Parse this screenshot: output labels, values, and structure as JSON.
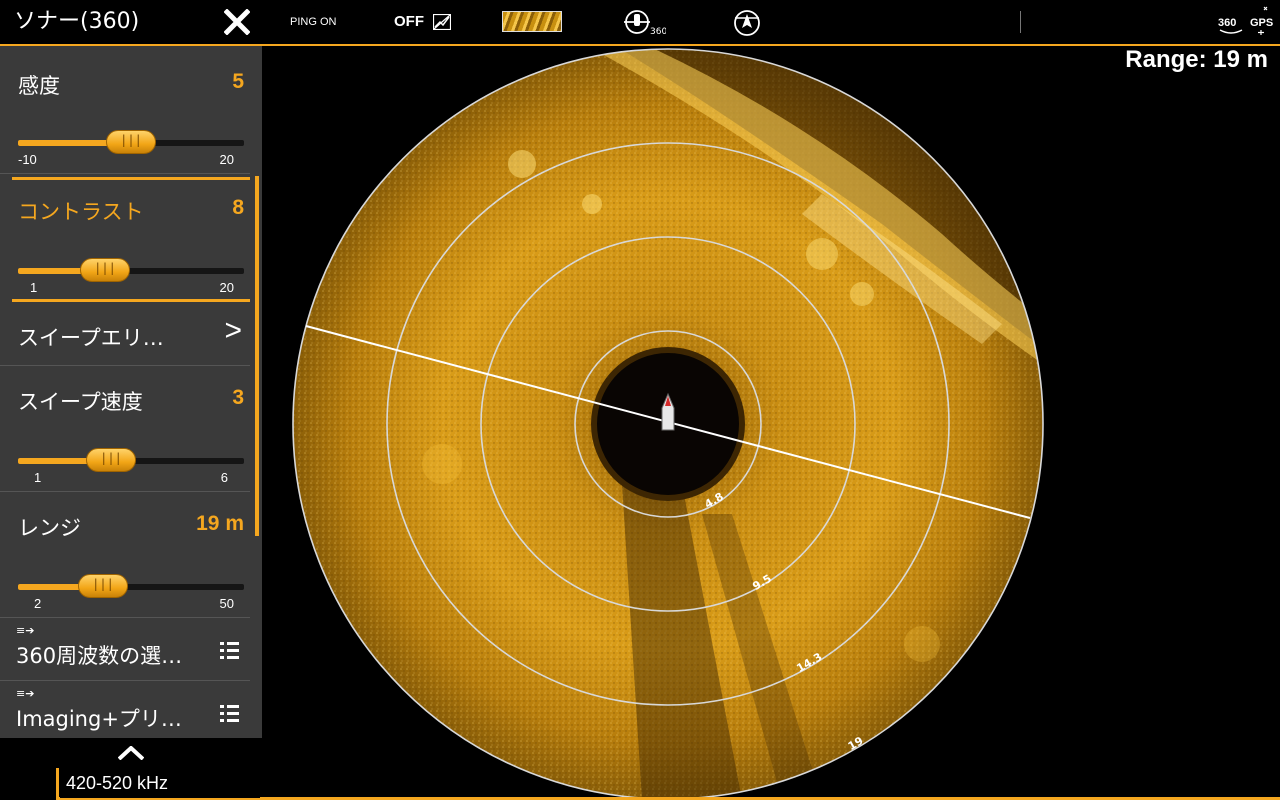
{
  "menu": {
    "title": "ソナー(360)",
    "items": [
      {
        "label": "感度",
        "value": "5",
        "min": "-10",
        "max": "20",
        "level": 0.5
      },
      {
        "label": "コントラスト",
        "value": "8",
        "min": "1",
        "max": "20",
        "level": 0.37
      },
      {
        "label": "スイープエリ…"
      },
      {
        "label": "スイープ速度",
        "value": "3",
        "min": "1",
        "max": "6",
        "level": 0.4
      },
      {
        "label": "レンジ",
        "value": "19 m",
        "min": "2",
        "max": "50",
        "level": 0.33
      },
      {
        "label": "360周波数の選…"
      },
      {
        "label": "Imaging+プリ…"
      }
    ]
  },
  "topbar": {
    "ping": "PING ON",
    "off": "OFF",
    "icon360_label": "360",
    "gps_label": "GPS",
    "transducer_label": "360"
  },
  "sonar": {
    "range_label": "Range: 19 m",
    "rings": [
      "4.8",
      "9.5",
      "14.3",
      "19"
    ]
  },
  "status": {
    "frequency": "420-520 kHz"
  },
  "colors": {
    "accent": "#f5a71f",
    "sonar_bright": "#f8c53c",
    "sonar_dark": "#5a3a05"
  }
}
